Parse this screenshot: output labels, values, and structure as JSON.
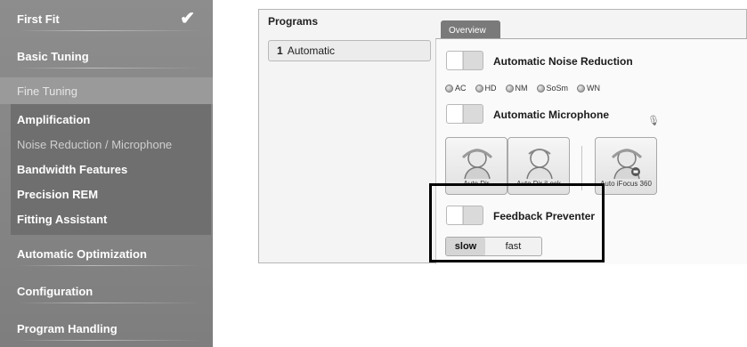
{
  "sidebar": {
    "items": [
      {
        "label": "First Fit"
      },
      {
        "label": "Basic Tuning"
      },
      {
        "label": "Fine Tuning"
      },
      {
        "label": "Automatic Optimization"
      },
      {
        "label": "Configuration"
      },
      {
        "label": "Program Handling"
      }
    ],
    "fine_tuning_subitems": [
      {
        "label": "Amplification"
      },
      {
        "label": "Noise Reduction / Microphone"
      },
      {
        "label": "Bandwidth Features"
      },
      {
        "label": "Precision REM"
      },
      {
        "label": "Fitting Assistant"
      }
    ]
  },
  "programs": {
    "title": "Programs",
    "items": [
      {
        "number": "1",
        "name": "Automatic"
      }
    ]
  },
  "tabs": [
    {
      "label": "Overview"
    }
  ],
  "features": {
    "noise_reduction": {
      "label": "Automatic Noise Reduction",
      "options": [
        "AC",
        "HD",
        "NM",
        "SoSm",
        "WN"
      ]
    },
    "microphone": {
      "label": "Automatic Microphone",
      "modes": [
        "Auto Dir",
        "Auto Dir iLock",
        "Auto iFocus 360"
      ]
    },
    "feedback": {
      "label": "Feedback Preventer",
      "speeds": [
        "slow",
        "fast"
      ],
      "selected": "slow"
    }
  },
  "icons": {
    "check": "checkmark-icon",
    "microphone": "microphone-icon",
    "head": "head-icon"
  },
  "colors": {
    "sidebar_bg": "#8d8d8d",
    "subgroup_bg": "#6f6f6f",
    "tab_bg": "#7a7a7a",
    "highlight_border": "#000000"
  }
}
